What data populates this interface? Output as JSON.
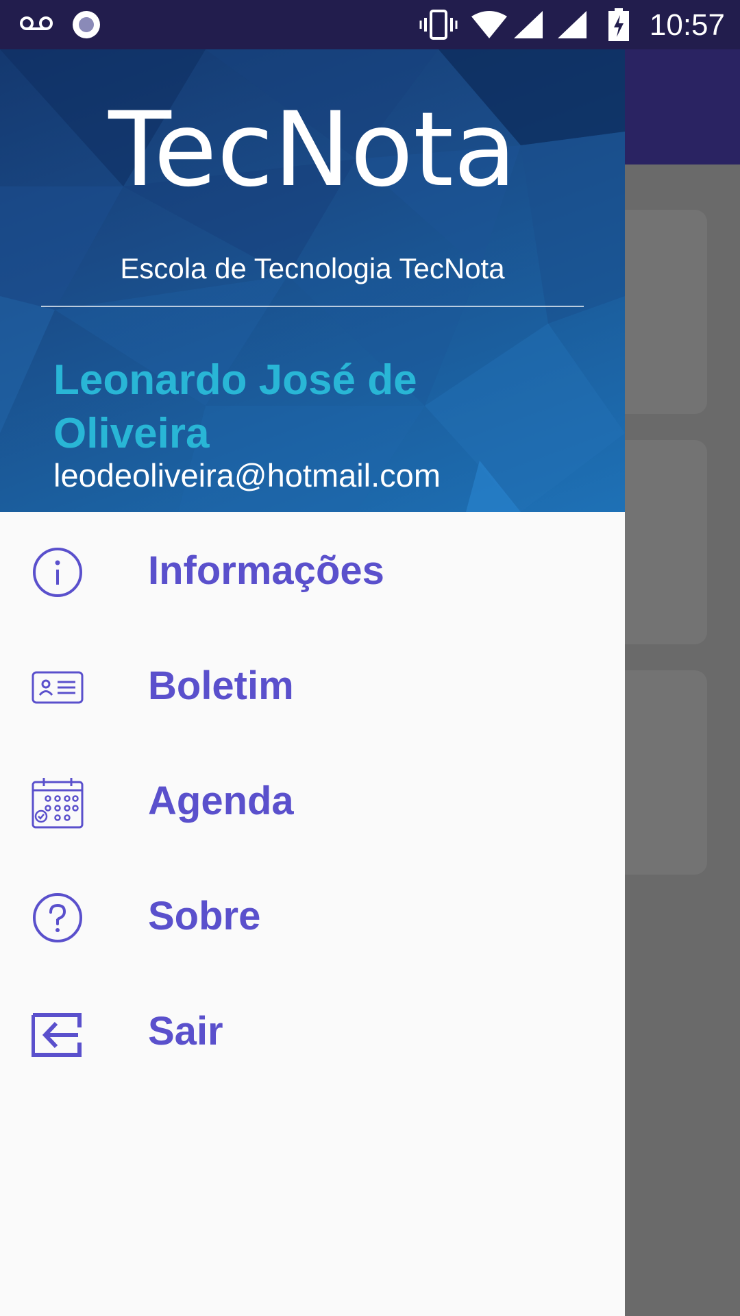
{
  "status_bar": {
    "time": "10:57",
    "icons": [
      "voicemail-icon",
      "circle-notification-icon",
      "vibrate-icon",
      "wifi-icon",
      "signal-icon",
      "signal-icon",
      "battery-charging-icon"
    ]
  },
  "drawer": {
    "header": {
      "app_title": "TecNota",
      "school_name": "Escola de Tecnologia TecNota",
      "user_name": "Leonardo José de Oliveira",
      "user_email": "leodeoliveira@hotmail.com"
    },
    "menu": [
      {
        "label": "Informações",
        "icon": "info-icon"
      },
      {
        "label": "Boletim",
        "icon": "id-card-icon"
      },
      {
        "label": "Agenda",
        "icon": "calendar-icon"
      },
      {
        "label": "Sobre",
        "icon": "help-icon"
      },
      {
        "label": "Sair",
        "icon": "logout-icon"
      }
    ]
  },
  "colors": {
    "accent": "#5a50cc",
    "user_name": "#29b6d6",
    "header_dark": "#14386f",
    "header_light": "#1e71b6",
    "status_bar": "#221d4d",
    "toolbar": "#2a2362"
  }
}
